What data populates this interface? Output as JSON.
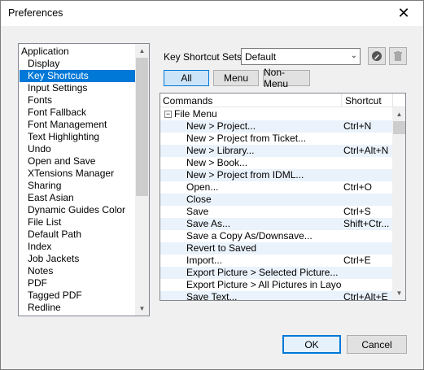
{
  "window": {
    "title": "Preferences",
    "close_glyph": "✕"
  },
  "categories": {
    "items": [
      {
        "label": "Application",
        "sub": false,
        "selected": false
      },
      {
        "label": "Display",
        "sub": true,
        "selected": false
      },
      {
        "label": "Key Shortcuts",
        "sub": true,
        "selected": true
      },
      {
        "label": "Input Settings",
        "sub": true,
        "selected": false
      },
      {
        "label": "Fonts",
        "sub": true,
        "selected": false
      },
      {
        "label": "Font Fallback",
        "sub": true,
        "selected": false
      },
      {
        "label": "Font Management",
        "sub": true,
        "selected": false
      },
      {
        "label": "Text Highlighting",
        "sub": true,
        "selected": false
      },
      {
        "label": "Undo",
        "sub": true,
        "selected": false
      },
      {
        "label": "Open and Save",
        "sub": true,
        "selected": false
      },
      {
        "label": "XTensions Manager",
        "sub": true,
        "selected": false
      },
      {
        "label": "Sharing",
        "sub": true,
        "selected": false
      },
      {
        "label": "East Asian",
        "sub": true,
        "selected": false
      },
      {
        "label": "Dynamic Guides Color",
        "sub": true,
        "selected": false
      },
      {
        "label": "File List",
        "sub": true,
        "selected": false
      },
      {
        "label": "Default Path",
        "sub": true,
        "selected": false
      },
      {
        "label": "Index",
        "sub": true,
        "selected": false
      },
      {
        "label": "Job Jackets",
        "sub": true,
        "selected": false
      },
      {
        "label": "Notes",
        "sub": true,
        "selected": false
      },
      {
        "label": "PDF",
        "sub": true,
        "selected": false
      },
      {
        "label": "Tagged PDF",
        "sub": true,
        "selected": false
      },
      {
        "label": "Redline",
        "sub": true,
        "selected": false
      }
    ]
  },
  "shortcuts": {
    "sets_label": "Key Shortcut Sets:",
    "sets_value": "Default",
    "filters": [
      "All",
      "Menu",
      "Non-Menu"
    ],
    "active_filter": "All",
    "columns": {
      "commands": "Commands",
      "shortcut": "Shortcut"
    },
    "rows": [
      {
        "command": "File Menu",
        "shortcut": "",
        "group": true
      },
      {
        "command": "New > Project...",
        "shortcut": "Ctrl+N",
        "group": false
      },
      {
        "command": "New > Project from Ticket...",
        "shortcut": "",
        "group": false
      },
      {
        "command": "New > Library...",
        "shortcut": "Ctrl+Alt+N",
        "group": false
      },
      {
        "command": "New > Book...",
        "shortcut": "",
        "group": false
      },
      {
        "command": "New > Project from IDML...",
        "shortcut": "",
        "group": false
      },
      {
        "command": "Open...",
        "shortcut": "Ctrl+O",
        "group": false
      },
      {
        "command": "Close",
        "shortcut": "",
        "group": false
      },
      {
        "command": "Save",
        "shortcut": "Ctrl+S",
        "group": false
      },
      {
        "command": "Save As...",
        "shortcut": "Shift+Ctr...",
        "group": false
      },
      {
        "command": "Save a Copy As/Downsave...",
        "shortcut": "",
        "group": false
      },
      {
        "command": "Revert to Saved",
        "shortcut": "",
        "group": false
      },
      {
        "command": "Import...",
        "shortcut": "Ctrl+E",
        "group": false
      },
      {
        "command": "Export Picture > Selected Picture...",
        "shortcut": "",
        "group": false
      },
      {
        "command": "Export Picture > All Pictures in Layo...",
        "shortcut": "",
        "group": false
      },
      {
        "command": "Save Text...",
        "shortcut": "Ctrl+Alt+E",
        "group": false
      }
    ]
  },
  "buttons": {
    "ok": "OK",
    "cancel": "Cancel"
  },
  "colors": {
    "selection": "#0078d7",
    "alt_row": "#eaf2fb",
    "active_filter": "#cce4f7"
  }
}
